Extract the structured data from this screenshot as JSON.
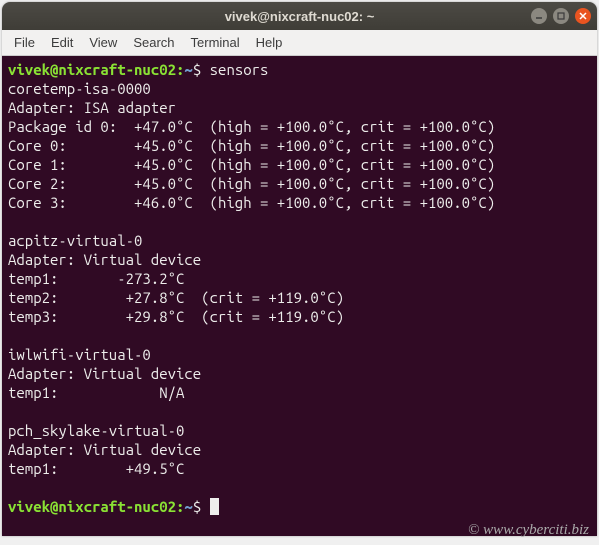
{
  "window": {
    "title": "vivek@nixcraft-nuc02: ~"
  },
  "menubar": {
    "items": [
      "File",
      "Edit",
      "View",
      "Search",
      "Terminal",
      "Help"
    ]
  },
  "prompt": {
    "user_host": "vivek@nixcraft-nuc02",
    "path": "~",
    "command": "sensors"
  },
  "sensors": {
    "coretemp": {
      "name": "coretemp-isa-0000",
      "adapter_label": "Adapter: ISA adapter",
      "rows": [
        "Package id 0:  +47.0°C  (high = +100.0°C, crit = +100.0°C)",
        "Core 0:        +45.0°C  (high = +100.0°C, crit = +100.0°C)",
        "Core 1:        +45.0°C  (high = +100.0°C, crit = +100.0°C)",
        "Core 2:        +45.0°C  (high = +100.0°C, crit = +100.0°C)",
        "Core 3:        +46.0°C  (high = +100.0°C, crit = +100.0°C)"
      ]
    },
    "acpitz": {
      "name": "acpitz-virtual-0",
      "adapter_label": "Adapter: Virtual device",
      "rows": [
        "temp1:       -273.2°C",
        "temp2:        +27.8°C  (crit = +119.0°C)",
        "temp3:        +29.8°C  (crit = +119.0°C)"
      ]
    },
    "iwlwifi": {
      "name": "iwlwifi-virtual-0",
      "adapter_label": "Adapter: Virtual device",
      "rows": [
        "temp1:            N/A"
      ]
    },
    "pch": {
      "name": "pch_skylake-virtual-0",
      "adapter_label": "Adapter: Virtual device",
      "rows": [
        "temp1:        +49.5°C"
      ]
    }
  },
  "watermark": "© www.cyberciti.biz"
}
